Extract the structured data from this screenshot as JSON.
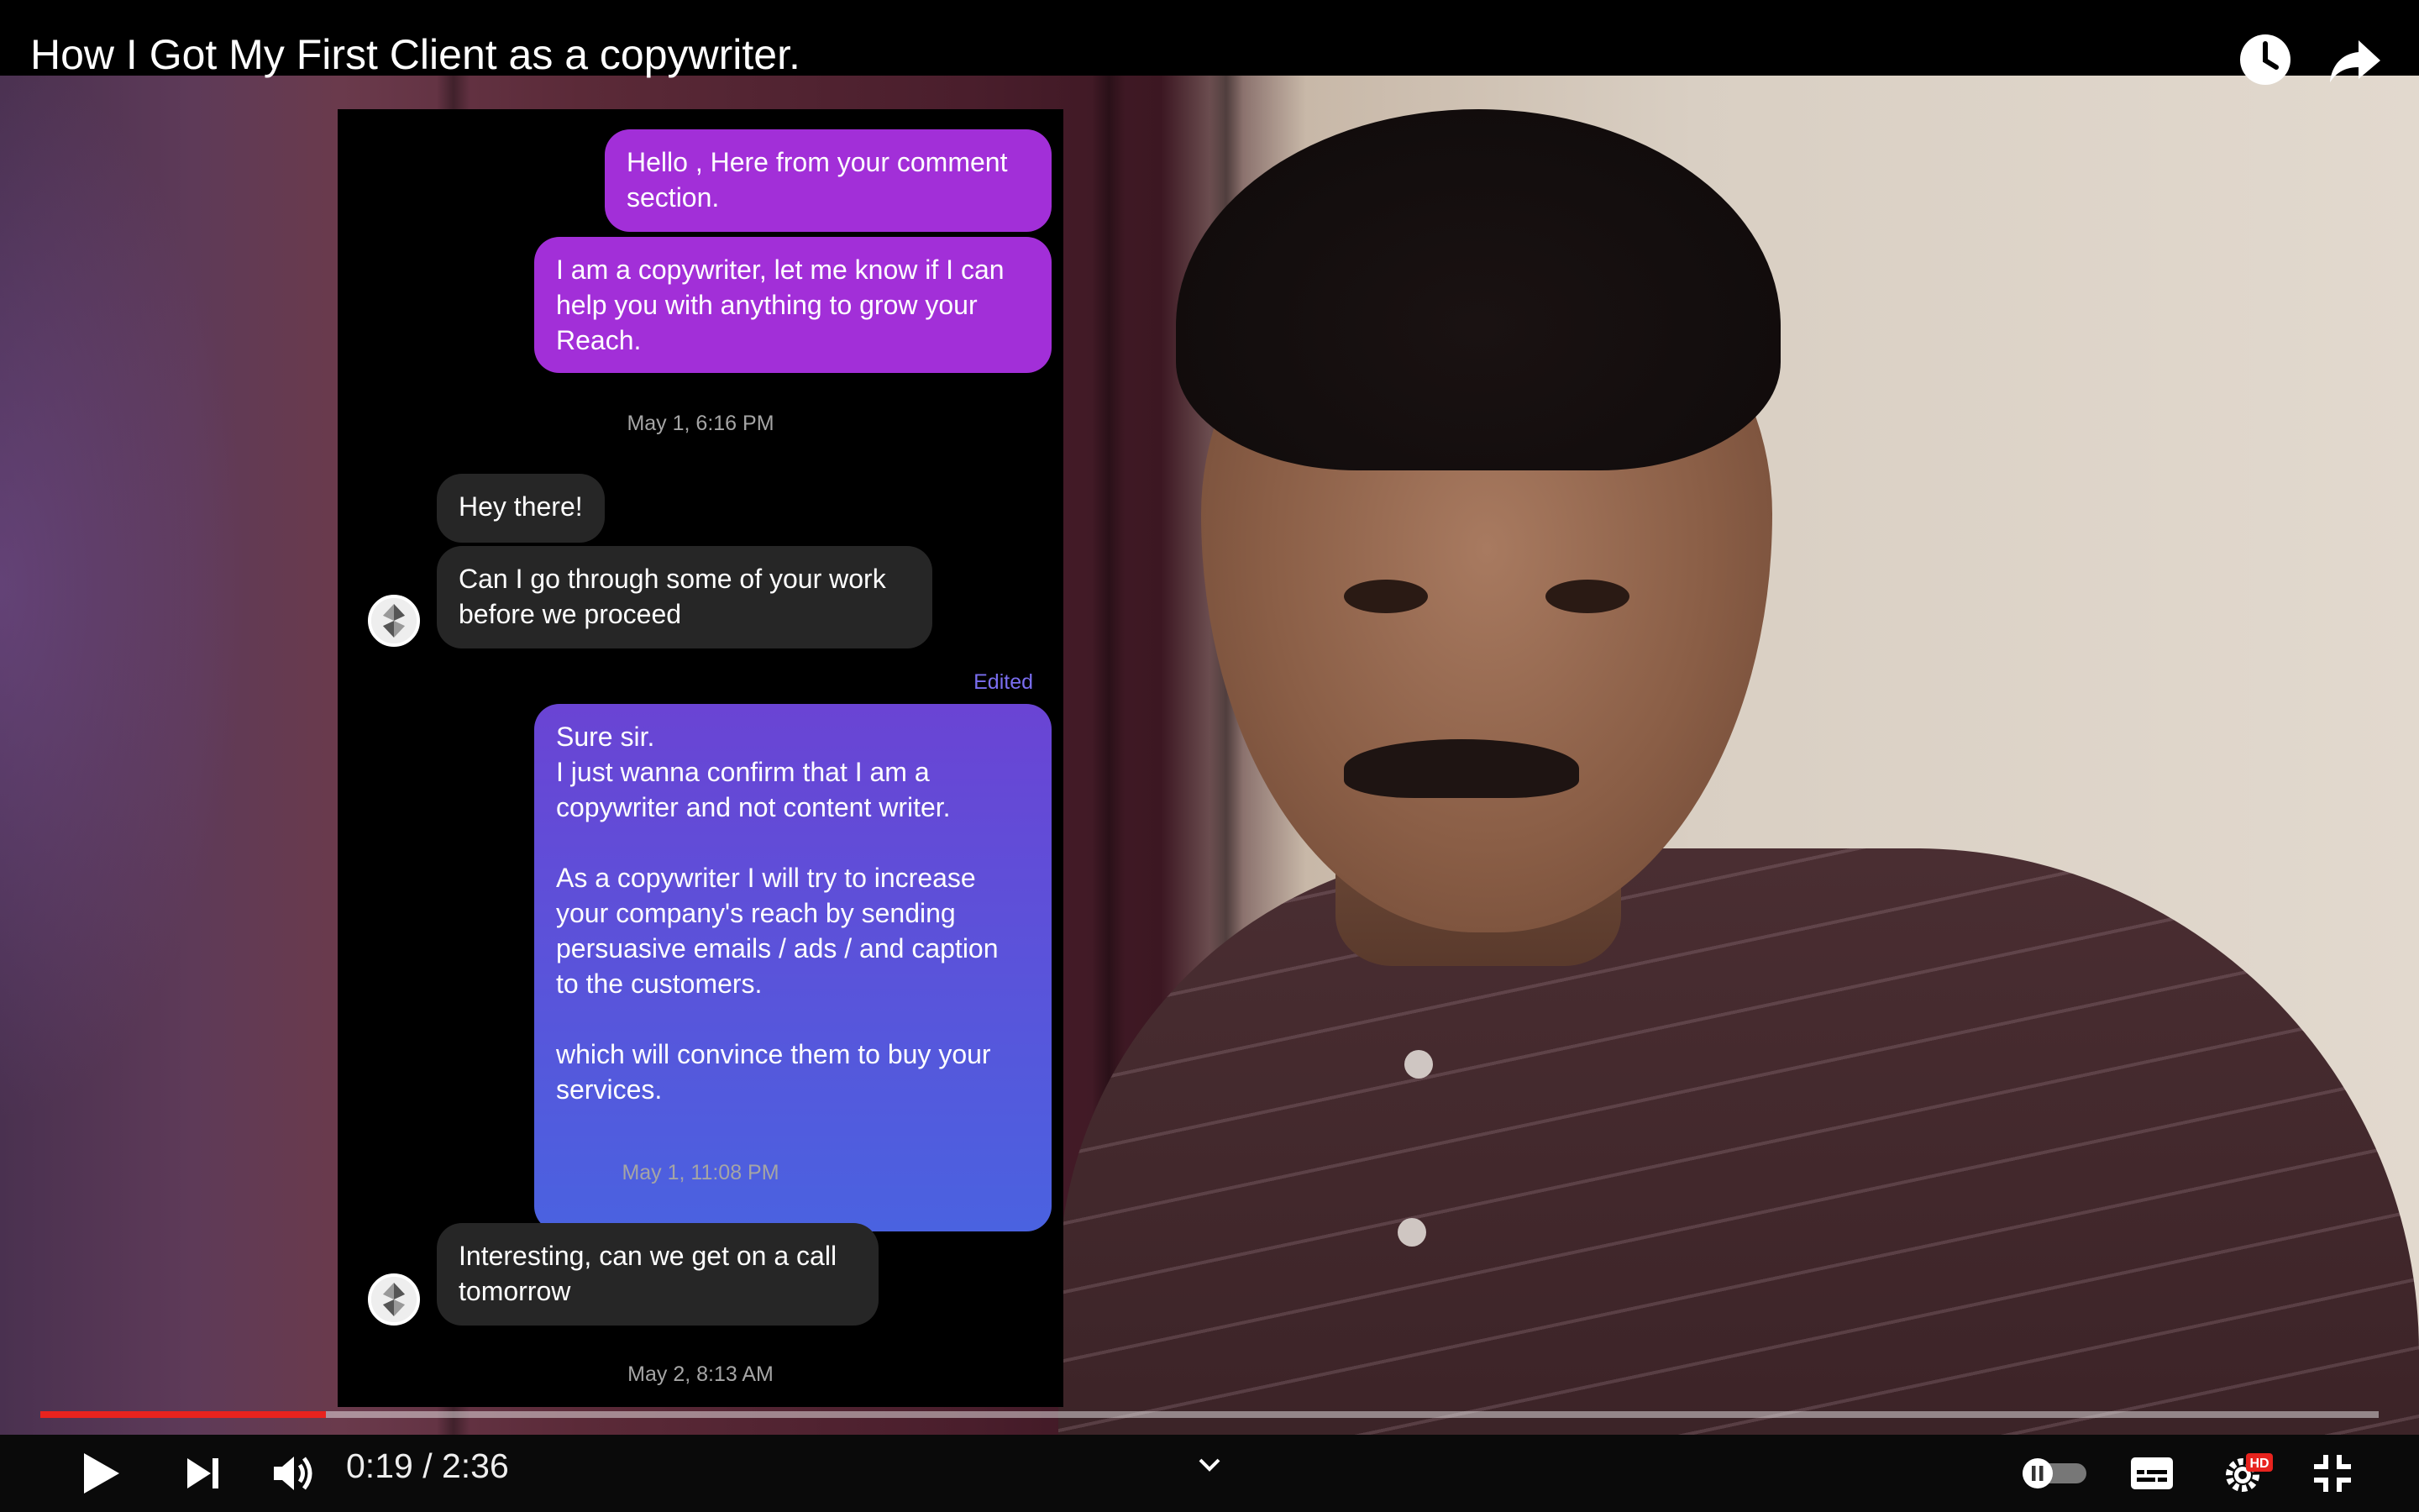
{
  "window": {
    "video_title": "How I Got My First Client as a copywriter."
  },
  "top_actions": [
    {
      "name": "watch-later",
      "icon": "clock-icon"
    },
    {
      "name": "share",
      "icon": "share-arrow-icon"
    }
  ],
  "chat": {
    "messages": [
      {
        "direction": "outgoing",
        "text": "Hello , Here from your comment\nsection."
      },
      {
        "direction": "outgoing",
        "text": "I am a copywriter, let me know if I can\nhelp you with anything to grow your\nReach."
      },
      {
        "timestamp": "May 1, 6:16 PM"
      },
      {
        "direction": "incoming",
        "text": "Hey there!"
      },
      {
        "direction": "incoming",
        "text": "Can I go through some of your work\nbefore we proceed"
      },
      {
        "status": "Edited"
      },
      {
        "direction": "outgoing",
        "text": "Sure sir.\nI just wanna confirm that I am a\ncopywriter and not content writer.\n\nAs a copywriter I will try to increase\nyour company's reach by sending\npersuasive emails / ads / and caption\nto the customers.\n\nwhich will convince them to buy your\nservices."
      },
      {
        "timestamp": "May 1, 11:08 PM"
      },
      {
        "direction": "incoming",
        "text": "Interesting, can we get on a call\ntomorrow"
      },
      {
        "timestamp": "May 2, 8:13 AM"
      }
    ]
  },
  "player": {
    "current_time": "0:19",
    "duration": "2:36",
    "time_display": "0:19 / 2:36",
    "progress_fraction": 0.122,
    "accent_color": "#e8231e",
    "quality_badge": "HD",
    "controls": [
      "play-icon",
      "next-icon",
      "volume-icon",
      "chevron-down-icon",
      "autoplay-toggle",
      "subtitles-icon",
      "settings-gear-icon",
      "exit-fullscreen-icon"
    ]
  }
}
